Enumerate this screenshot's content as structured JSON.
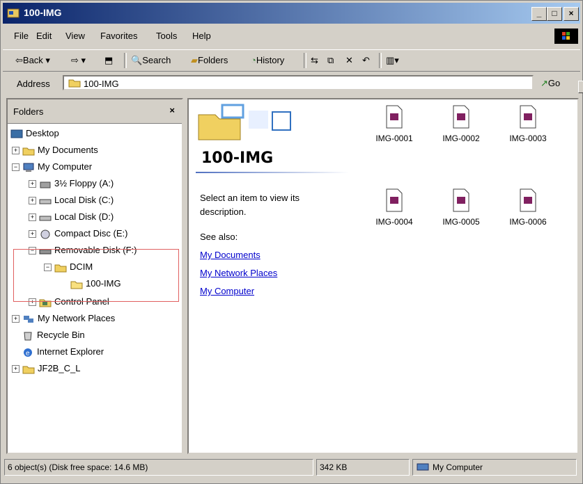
{
  "window": {
    "title": "100-IMG"
  },
  "menu": [
    "File",
    "Edit",
    "View",
    "Favorites",
    "Tools",
    "Help"
  ],
  "toolbar": {
    "back": "Back",
    "search": "Search",
    "folders": "Folders",
    "history": "History"
  },
  "address": {
    "label": "Address",
    "value": "100-IMG",
    "go": "Go"
  },
  "folders_pane": {
    "title": "Folders",
    "tree": [
      {
        "label": "Desktop"
      },
      {
        "label": "My Documents"
      },
      {
        "label": "My Computer"
      },
      {
        "label": "3½ Floppy (A:)"
      },
      {
        "label": "Local Disk (C:)"
      },
      {
        "label": "Local Disk (D:)"
      },
      {
        "label": "Compact Disc (E:)"
      },
      {
        "label": "Removable Disk (F:)"
      },
      {
        "label": "DCIM"
      },
      {
        "label": "100-IMG"
      },
      {
        "label": "Control Panel"
      },
      {
        "label": "My Network Places"
      },
      {
        "label": "Recycle Bin"
      },
      {
        "label": "Internet Explorer"
      },
      {
        "label": "JF2B_C_L"
      }
    ]
  },
  "content": {
    "folder_title": "100-IMG",
    "description": "Select an item to view its description.",
    "see_also": "See also:",
    "links": [
      "My Documents",
      "My Network Places",
      "My Computer"
    ],
    "files": [
      "IMG-0001",
      "IMG-0002",
      "IMG-0003",
      "IMG-0004",
      "IMG-0005",
      "IMG-0006"
    ]
  },
  "status": {
    "objects": "6 object(s) (Disk free space: 14.6 MB)",
    "size": "342 KB",
    "zone": "My Computer"
  },
  "colors": {
    "title_start": "#0a246a",
    "title_end": "#a6caf0",
    "link": "#0000cc",
    "highlight_box": "#e06060"
  }
}
